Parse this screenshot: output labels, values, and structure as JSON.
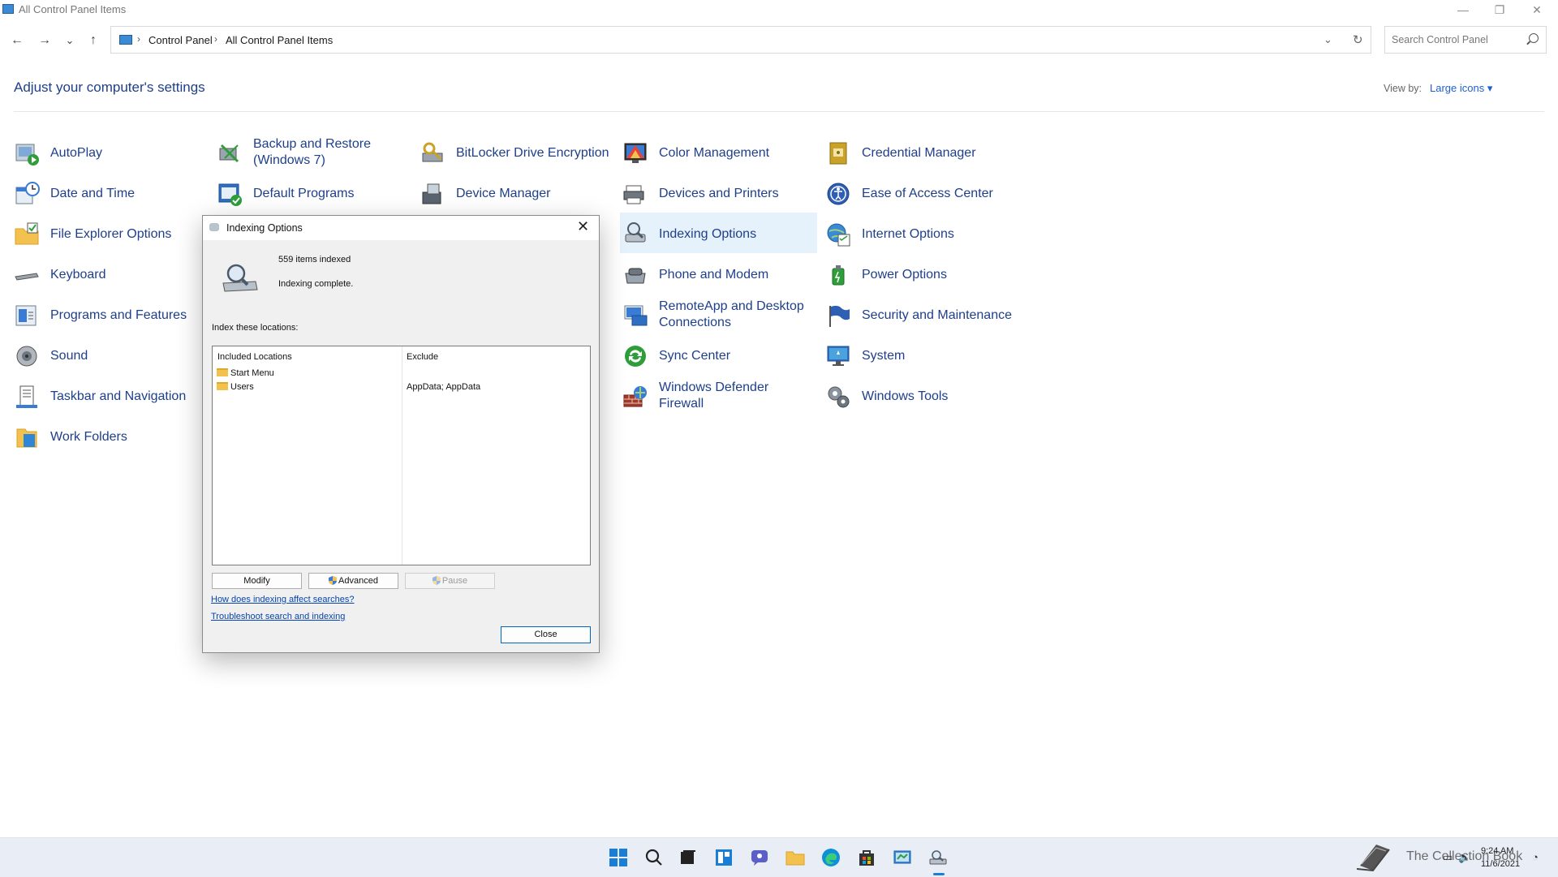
{
  "window": {
    "title": "All Control Panel Items",
    "minimize": "—",
    "restore": "❐",
    "close": "✕"
  },
  "nav": {
    "back": "←",
    "forward": "→",
    "recent": "⌄",
    "up": "↑",
    "separator": "›",
    "breadcrumb": [
      "Control Panel",
      "All Control Panel Items"
    ],
    "dropdown": "⌄",
    "refresh": "↻",
    "search_placeholder": "Search Control Panel"
  },
  "header": {
    "title": "Adjust your computer's settings",
    "view_by_label": "View by:",
    "view_by_value": "Large icons ▾"
  },
  "items": [
    {
      "label": "AutoPlay",
      "icon": "autoplay-icon"
    },
    {
      "label": "Backup and Restore (Windows 7)",
      "line1": "Backup and Restore",
      "line2": "(Windows 7)",
      "icon": "backup-restore-icon"
    },
    {
      "label": "BitLocker Drive Encryption",
      "icon": "bitlocker-icon"
    },
    {
      "label": "Color Management",
      "icon": "color-management-icon"
    },
    {
      "label": "Credential Manager",
      "icon": "credential-manager-icon"
    },
    {
      "label": "Date and Time",
      "icon": "date-time-icon"
    },
    {
      "label": "Default Programs",
      "icon": "default-programs-icon"
    },
    {
      "label": "Device Manager",
      "icon": "device-manager-icon"
    },
    {
      "label": "Devices and Printers",
      "icon": "devices-printers-icon"
    },
    {
      "label": "Ease of Access Center",
      "icon": "ease-of-access-icon"
    },
    {
      "label": "File Explorer Options",
      "icon": "file-explorer-options-icon"
    },
    {
      "label": "Indexing Options",
      "icon": "indexing-options-icon",
      "selected": true
    },
    {
      "label": "Internet Options",
      "icon": "internet-options-icon"
    },
    {
      "label": "Keyboard",
      "icon": "keyboard-icon"
    },
    {
      "label": "Phone and Modem",
      "icon": "phone-modem-icon"
    },
    {
      "label": "Power Options",
      "icon": "power-options-icon"
    },
    {
      "label": "Programs and Features",
      "icon": "programs-features-icon"
    },
    {
      "label": "RemoteApp and Desktop Connections",
      "line1": "RemoteApp and Desktop",
      "line2": "Connections",
      "icon": "remoteapp-icon"
    },
    {
      "label": "Security and Maintenance",
      "icon": "security-maintenance-icon"
    },
    {
      "label": "Sound",
      "icon": "sound-icon"
    },
    {
      "label": "Sync Center",
      "icon": "sync-center-icon"
    },
    {
      "label": "System",
      "icon": "system-icon"
    },
    {
      "label": "Taskbar and Navigation",
      "icon": "taskbar-navigation-icon"
    },
    {
      "label": "Windows Defender Firewall",
      "line1": "Windows Defender",
      "line2": "Firewall",
      "icon": "firewall-icon"
    },
    {
      "label": "Windows Tools",
      "icon": "windows-tools-icon"
    },
    {
      "label": "Work Folders",
      "icon": "work-folders-icon"
    }
  ],
  "dialog": {
    "title": "Indexing Options",
    "close": "✕",
    "items_indexed": "559 items indexed",
    "status": "Indexing complete.",
    "locations_label": "Index these locations:",
    "columns": {
      "included": "Included Locations",
      "exclude": "Exclude"
    },
    "rows": [
      {
        "location": "Start Menu",
        "exclude": ""
      },
      {
        "location": "Users",
        "exclude": "AppData; AppData"
      }
    ],
    "buttons": {
      "modify": "Modify",
      "advanced": "Advanced",
      "pause": "Pause",
      "close": "Close"
    },
    "links": {
      "how": "How does indexing affect searches?",
      "troubleshoot": "Troubleshoot search and indexing"
    }
  },
  "taskbar": {
    "time": "9:24 AM",
    "date": "11/6/2021",
    "watermark": "The Collection Book",
    "apps": [
      "start-icon",
      "search-icon",
      "task-view-icon",
      "widgets-icon",
      "chat-icon",
      "file-explorer-icon",
      "edge-icon",
      "store-icon",
      "control-panel-icon",
      "indexing-options-icon"
    ]
  }
}
